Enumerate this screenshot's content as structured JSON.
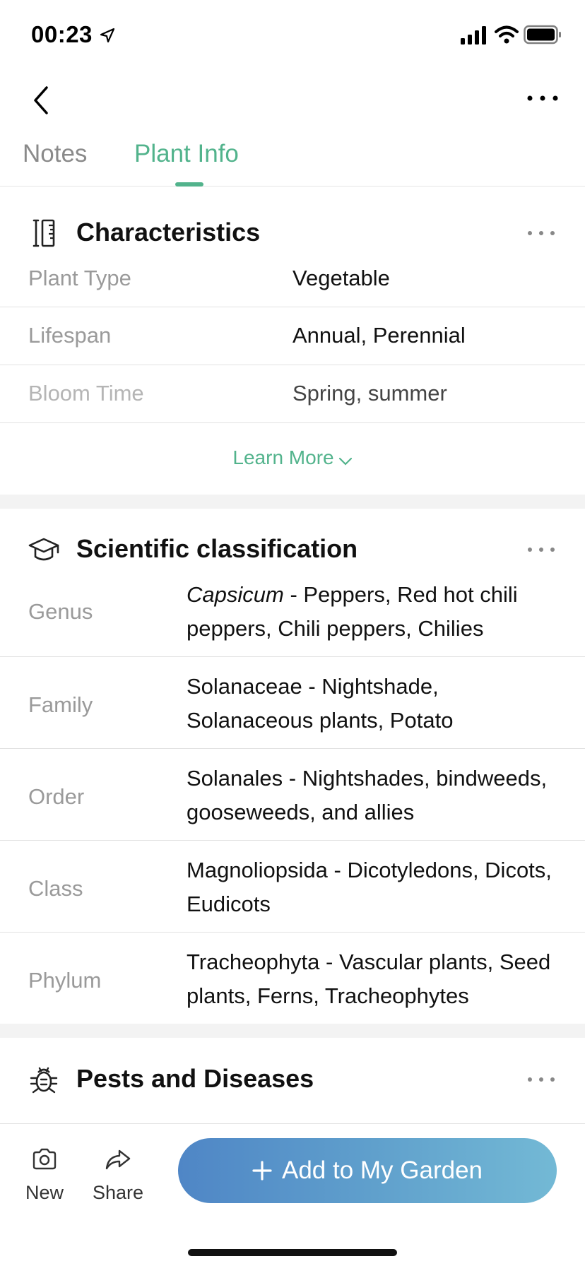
{
  "status_bar": {
    "time": "00:23"
  },
  "tabs": [
    {
      "label": "Notes",
      "active": false
    },
    {
      "label": "Plant Info",
      "active": true
    }
  ],
  "colors": {
    "accent": "#52b38c",
    "button_start": "#4f86c6",
    "button_end": "#73b9d5"
  },
  "characteristics": {
    "title": "Characteristics",
    "icon": "ruler-icon",
    "rows": [
      {
        "label": "Plant Type",
        "value": "Vegetable"
      },
      {
        "label": "Lifespan",
        "value": "Annual, Perennial"
      },
      {
        "label": "Bloom Time",
        "value": "Spring, summer"
      }
    ],
    "learn_more": "Learn More"
  },
  "classification": {
    "title": "Scientific classification",
    "icon": "graduation-cap-icon",
    "rows": [
      {
        "label": "Genus",
        "value_italic": "Capsicum",
        "value": " - Peppers, Red hot chili peppers, Chili peppers, Chilies"
      },
      {
        "label": "Family",
        "value": "Solanaceae - Nightshade, Solanaceous plants, Potato"
      },
      {
        "label": "Order",
        "value": "Solanales - Nightshades, bindweeds, gooseweeds, and allies"
      },
      {
        "label": "Class",
        "value": "Magnoliopsida - Dicotyledons, Dicots, Eudicots"
      },
      {
        "label": "Phylum",
        "value": "Tracheophyta - Vascular plants, Seed plants, Ferns, Tracheophytes"
      }
    ]
  },
  "pests": {
    "title": "Pests and Diseases",
    "icon": "bug-icon"
  },
  "bottom_bar": {
    "new_label": "New",
    "share_label": "Share",
    "add_label": "Add to My Garden"
  }
}
